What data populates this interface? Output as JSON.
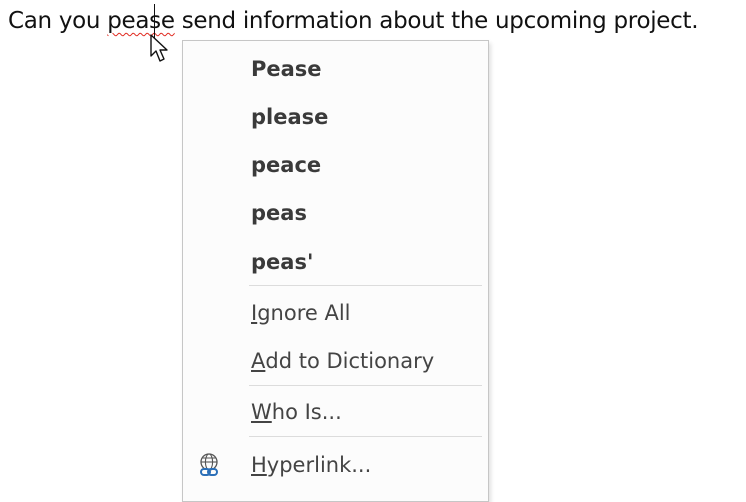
{
  "document": {
    "before": "Can you ",
    "misspelled_word": "pease",
    "after": " send information about the upcoming project."
  },
  "context_menu": {
    "suggestions": [
      "Pease",
      "please",
      "peace",
      "peas",
      "peas'"
    ],
    "ignore_all": {
      "accel": "I",
      "rest": "gnore All"
    },
    "add_to_dictionary": {
      "accel": "A",
      "rest": "dd to Dictionary"
    },
    "who_is": {
      "accel": "W",
      "rest": "ho Is..."
    },
    "hyperlink": {
      "accel": "H",
      "rest": "yperlink..."
    }
  },
  "colors": {
    "spelling_underline": "#e0281e",
    "hyperlink_icon": "#2b6fb8"
  },
  "icons": {
    "hyperlink": "globe-link-icon",
    "pointer": "arrow-cursor-icon"
  }
}
